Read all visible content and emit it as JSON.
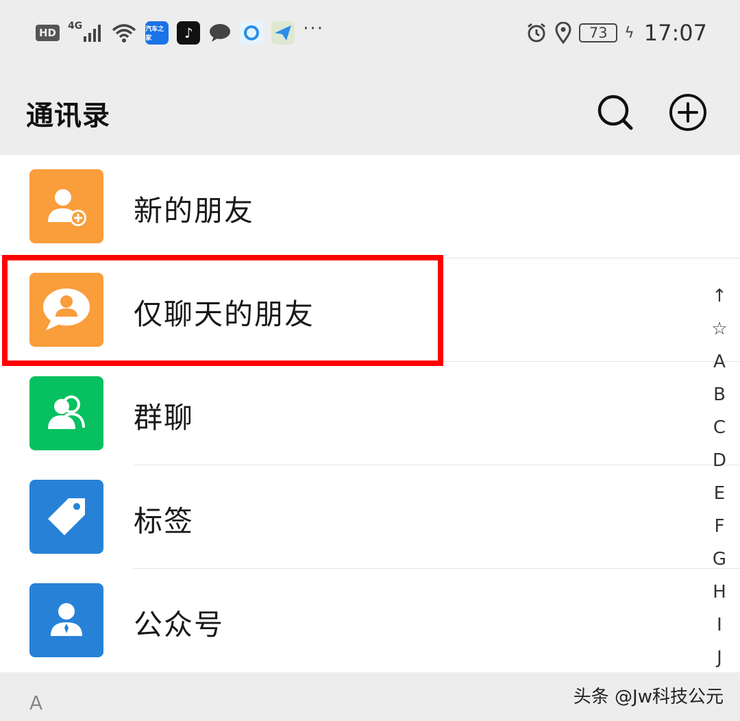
{
  "status_bar": {
    "hd_badge": "HD",
    "network_type": "4G",
    "car_app_label": "汽车之家",
    "battery_level": "73",
    "time": "17:07",
    "icons": [
      "signal-icon",
      "wifi-icon",
      "car-app-icon",
      "tiktok-icon",
      "message-icon",
      "q-app-icon",
      "paper-plane-icon",
      "more-dots-icon",
      "alarm-icon",
      "location-icon",
      "battery-icon",
      "charging-icon"
    ]
  },
  "header": {
    "title": "通讯录",
    "icons": [
      "search-icon",
      "add-circle-icon"
    ]
  },
  "list": {
    "items": [
      {
        "label": "新的朋友",
        "icon": "add-friend-icon",
        "color": "#fa9d3b"
      },
      {
        "label": "仅聊天的朋友",
        "icon": "chat-only-friend-icon",
        "color": "#fa9d3b"
      },
      {
        "label": "群聊",
        "icon": "group-chat-icon",
        "color": "#07c160"
      },
      {
        "label": "标签",
        "icon": "tag-icon",
        "color": "#2782d7"
      },
      {
        "label": "公众号",
        "icon": "official-account-icon",
        "color": "#2782d7"
      }
    ]
  },
  "section": {
    "letter": "A"
  },
  "index_bar": [
    "↑",
    "☆",
    "A",
    "B",
    "C",
    "D",
    "E",
    "F",
    "G",
    "H",
    "I",
    "J"
  ],
  "highlight_color": "#ff0000",
  "watermark": "头条 @Jw科技公元"
}
